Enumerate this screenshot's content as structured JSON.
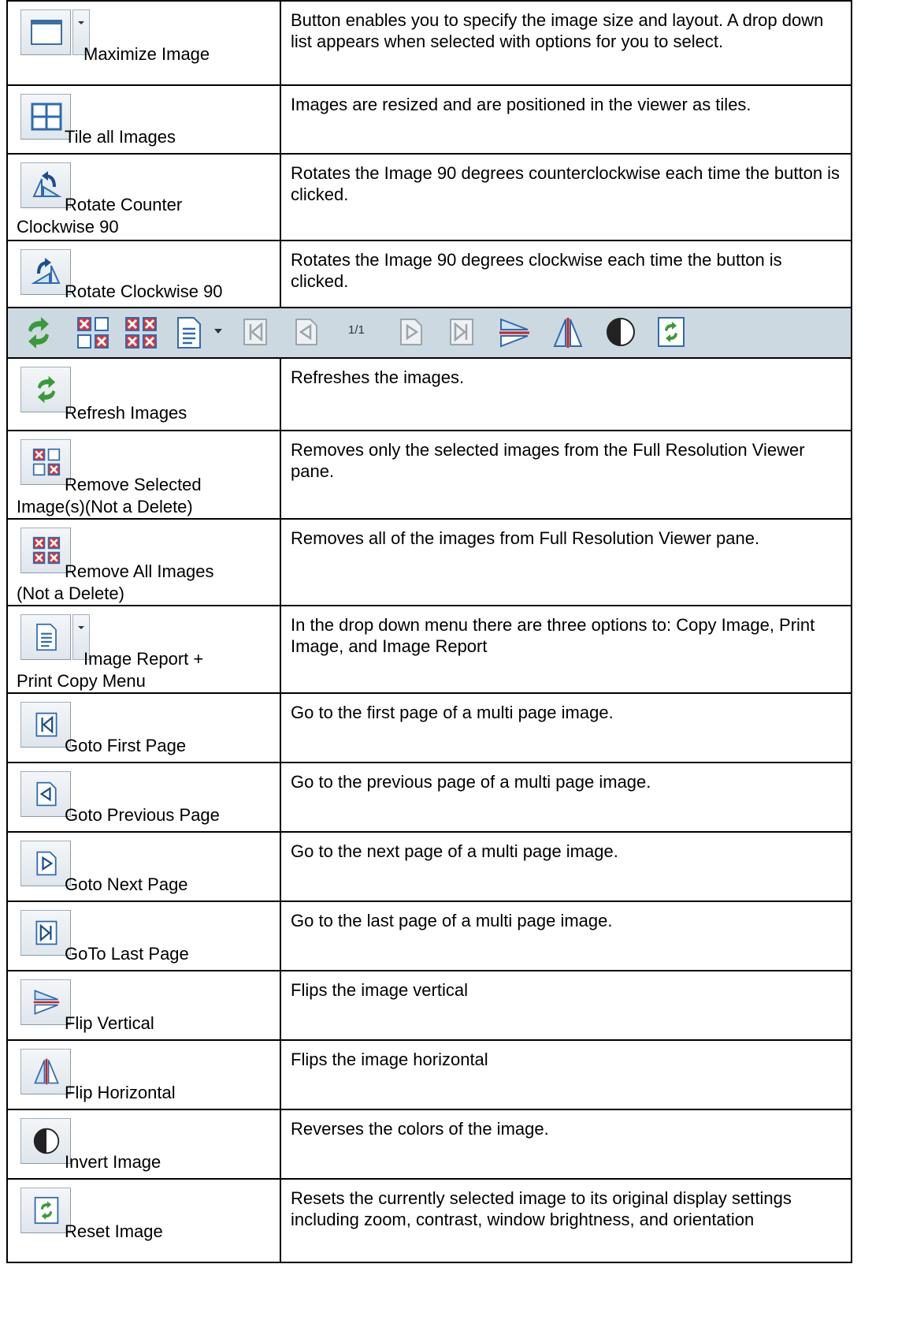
{
  "rows_top": [
    {
      "label_lines": [
        "Maximize Image"
      ],
      "description": "Button enables you to specify the image size and layout. A drop down list appears when selected with options for you to select.",
      "icon": "maximize-icon"
    },
    {
      "label_lines": [
        "Tile all Images"
      ],
      "description": "Images are resized and are positioned in the viewer as tiles.",
      "icon": "tile-icon"
    },
    {
      "label_lines": [
        "Rotate Counter",
        "Clockwise 90"
      ],
      "description": "Rotates the Image 90 degrees counterclockwise each time the button is clicked.",
      "icon": "rotate-ccw-icon"
    },
    {
      "label_lines": [
        "Rotate Clockwise 90"
      ],
      "description": "Rotates the Image 90 degrees clockwise each time the button is clicked.",
      "icon": "rotate-cw-icon"
    }
  ],
  "toolbar": {
    "page_indicator": "1/1",
    "icons": [
      "refresh-icon",
      "remove-selected-icon",
      "remove-all-icon",
      "report-icon",
      "dropdown-arrow-icon",
      "first-page-icon",
      "previous-page-icon",
      "next-page-icon",
      "last-page-icon",
      "flip-vertical-icon",
      "flip-horizontal-icon",
      "invert-icon",
      "reset-icon"
    ]
  },
  "rows_bottom": [
    {
      "label_lines": [
        "Refresh Images"
      ],
      "description": "Refreshes the images.",
      "icon": "refresh-icon"
    },
    {
      "label_lines": [
        "Remove Selected",
        "Image(s)(Not a Delete)"
      ],
      "description": "Removes only the selected images from the Full Resolution Viewer pane.",
      "icon": "remove-selected-icon"
    },
    {
      "label_lines": [
        "Remove All Images",
        "(Not a Delete)"
      ],
      "description": "Removes all of the images from Full Resolution Viewer pane.",
      "icon": "remove-all-icon"
    },
    {
      "label_lines": [
        "Image Report +",
        "Print Copy Menu"
      ],
      "description": "In the drop down menu there are three options to: Copy Image, Print Image, and Image Report",
      "icon": "report-icon"
    },
    {
      "label_lines": [
        "Goto First Page"
      ],
      "description": " Go to the first page of a multi page image.",
      "icon": "first-page-icon"
    },
    {
      "label_lines": [
        "Goto Previous Page"
      ],
      "description": "Go to the previous page of a multi page image.",
      "icon": "previous-page-icon"
    },
    {
      "label_lines": [
        "Goto Next Page"
      ],
      "description": "Go to the next page of a multi page image.",
      "icon": "next-page-icon"
    },
    {
      "label_lines": [
        "GoTo Last Page"
      ],
      "description": "Go to the last page of a multi page image.",
      "icon": "last-page-icon"
    },
    {
      "label_lines": [
        "Flip Vertical"
      ],
      "description": " Flips the image vertical",
      "icon": "flip-vertical-icon"
    },
    {
      "label_lines": [
        "Flip Horizontal"
      ],
      "description": "Flips the image horizontal",
      "icon": "flip-horizontal-icon"
    },
    {
      "label_lines": [
        "Invert Image"
      ],
      "description": " Reverses the colors of the image.",
      "icon": "invert-icon"
    },
    {
      "label_lines": [
        "Reset Image"
      ],
      "description": " Resets the currently selected image to its original display settings including zoom, contrast, window brightness, and orientation",
      "icon": "reset-icon"
    }
  ]
}
